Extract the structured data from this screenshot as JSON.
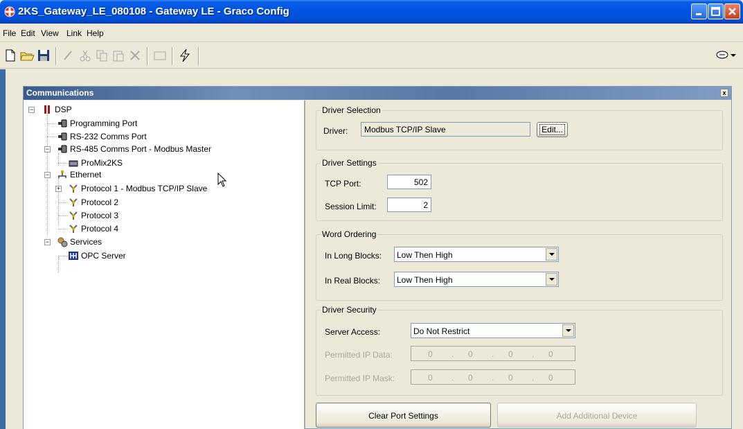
{
  "window": {
    "title": "2KS_Gateway_LE_080108 - Gateway LE - Graco Config"
  },
  "menu": [
    "File",
    "Edit",
    "View",
    "Link",
    "Help"
  ],
  "panel": {
    "title": "Communications",
    "close_glyph": "x"
  },
  "tree": {
    "nodes": [
      {
        "label": "DSP",
        "icon": "dsp-icon"
      },
      {
        "label": "Programming Port",
        "icon": "port-icon"
      },
      {
        "label": "RS-232 Comms Port",
        "icon": "port-icon"
      },
      {
        "label": "RS-485 Comms Port - Modbus Master",
        "icon": "port-icon"
      },
      {
        "label": "ProMix2KS",
        "icon": "device-icon"
      },
      {
        "label": "Ethernet",
        "icon": "network-icon"
      },
      {
        "label": "Protocol 1 - Modbus TCP/IP Slave",
        "icon": "protocol-icon"
      },
      {
        "label": "Protocol 2",
        "icon": "protocol-icon"
      },
      {
        "label": "Protocol 3",
        "icon": "protocol-icon"
      },
      {
        "label": "Protocol 4",
        "icon": "protocol-icon"
      },
      {
        "label": "Services",
        "icon": "services-icon"
      },
      {
        "label": "OPC Server",
        "icon": "opc-icon"
      }
    ]
  },
  "driver_selection": {
    "title": "Driver Selection",
    "driver_label": "Driver:",
    "driver_value": "Modbus TCP/IP Slave",
    "edit_button": "Edit..."
  },
  "driver_settings": {
    "title": "Driver Settings",
    "tcp_port_label": "TCP Port:",
    "tcp_port_value": "502",
    "session_limit_label": "Session Limit:",
    "session_limit_value": "2"
  },
  "word_ordering": {
    "title": "Word Ordering",
    "long_label": "In Long Blocks:",
    "long_value": "Low Then High",
    "real_label": "In Real Blocks:",
    "real_value": "Low Then High"
  },
  "driver_security": {
    "title": "Driver Security",
    "server_access_label": "Server Access:",
    "server_access_value": "Do Not Restrict",
    "ip_data_label": "Permitted IP Data:",
    "ip_mask_label": "Permitted IP Mask:",
    "ip_data": [
      "0",
      "0",
      "0",
      "0"
    ],
    "ip_mask": [
      "0",
      "0",
      "0",
      "0"
    ],
    "dot": "."
  },
  "buttons": {
    "clear": "Clear Port Settings",
    "add": "Add Additional Device"
  }
}
